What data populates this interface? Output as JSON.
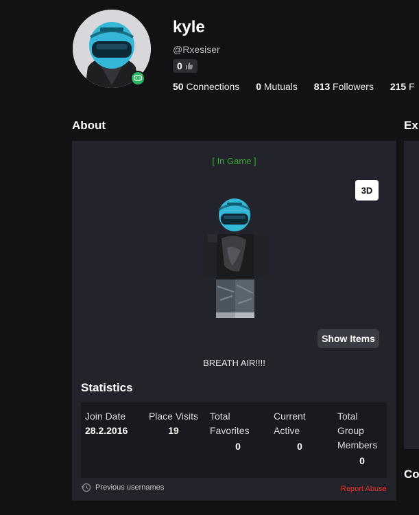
{
  "profile": {
    "display_name": "kyle",
    "username": "@Rxesiser",
    "badge_count": "0",
    "stats": {
      "connections_count": "50",
      "connections_label": "Connections",
      "mutuals_count": "0",
      "mutuals_label": "Mutuals",
      "followers_count": "813",
      "followers_label": "Followers",
      "following_count": "215",
      "following_label": "F"
    }
  },
  "about": {
    "title": "About",
    "status": "[ In Game ]",
    "view_toggle": "3D",
    "show_items": "Show Items",
    "blurb": "BREATH AIR!!!!"
  },
  "right_column": {
    "title_partial": "Ex",
    "bottom_partial": "Co"
  },
  "statistics": {
    "title": "Statistics",
    "items": [
      {
        "label": "Join Date",
        "value": "28.2.2016"
      },
      {
        "label": "Place Visits",
        "value": "19"
      },
      {
        "label": "Total Favorites",
        "value": "0"
      },
      {
        "label": "Current Active",
        "value": "0"
      },
      {
        "label": "Total Group Members",
        "value": "0"
      }
    ]
  },
  "footer": {
    "previous_usernames": "Previous usernames",
    "report_abuse": "Report Abuse"
  },
  "colors": {
    "background": "#121215",
    "panel": "#23242b",
    "in_game_green": "#39a935",
    "online_green": "#2fb561",
    "report_red": "#e0302a",
    "helmet_blue": "#35b8d8"
  },
  "icons": [
    "thumbs-up-icon",
    "gamepad-icon",
    "history-icon"
  ]
}
